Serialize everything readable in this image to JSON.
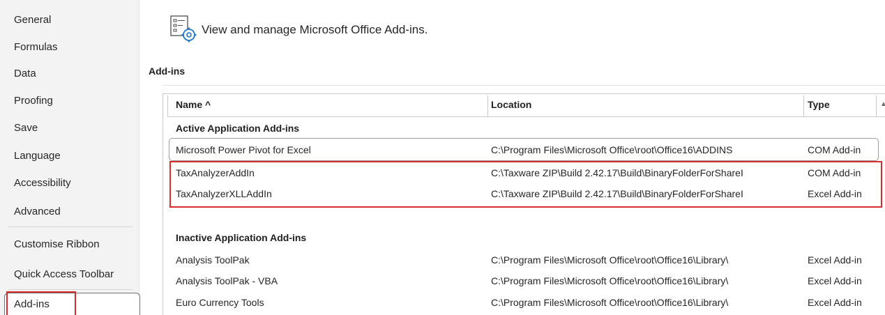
{
  "sidebar": {
    "items": [
      {
        "label": "General"
      },
      {
        "label": "Formulas"
      },
      {
        "label": "Data"
      },
      {
        "label": "Proofing"
      },
      {
        "label": "Save"
      },
      {
        "label": "Language"
      },
      {
        "label": "Accessibility"
      },
      {
        "label": "Advanced"
      },
      {
        "label": "Customise Ribbon"
      },
      {
        "label": "Quick Access Toolbar"
      },
      {
        "label": "Add-ins"
      }
    ],
    "selected": "Add-ins"
  },
  "header": {
    "icon": "addins-gear-icon",
    "text": "View and manage Microsoft Office Add-ins."
  },
  "section": {
    "title": "Add-ins"
  },
  "table": {
    "columns": [
      {
        "label": "Name ^"
      },
      {
        "label": "Location"
      },
      {
        "label": "Type"
      }
    ],
    "groups": [
      {
        "title": "Active Application Add-ins",
        "rows": [
          {
            "name": "Microsoft Power Pivot for Excel",
            "location": "C:\\Program Files\\Microsoft Office\\root\\Office16\\ADDINS",
            "type": "COM Add-in"
          },
          {
            "name": "TaxAnalyzerAddIn",
            "location": "C:\\Taxware ZIP\\Build 2.42.17\\Build\\BinaryFolderForShareI",
            "type": "COM Add-in"
          },
          {
            "name": "TaxAnalyzerXLLAddIn",
            "location": "C:\\Taxware ZIP\\Build 2.42.17\\Build\\BinaryFolderForShareI",
            "type": "Excel Add-in"
          }
        ]
      },
      {
        "title": "Inactive Application Add-ins",
        "rows": [
          {
            "name": "Analysis ToolPak",
            "location": "C:\\Program Files\\Microsoft Office\\root\\Office16\\Library\\",
            "type": "Excel Add-in"
          },
          {
            "name": "Analysis ToolPak - VBA",
            "location": "C:\\Program Files\\Microsoft Office\\root\\Office16\\Library\\",
            "type": "Excel Add-in"
          },
          {
            "name": "Euro Currency Tools",
            "location": "C:\\Program Files\\Microsoft Office\\root\\Office16\\Library\\",
            "type": "Excel Add-in"
          }
        ]
      }
    ]
  },
  "highlight_color": "#d92b2b"
}
